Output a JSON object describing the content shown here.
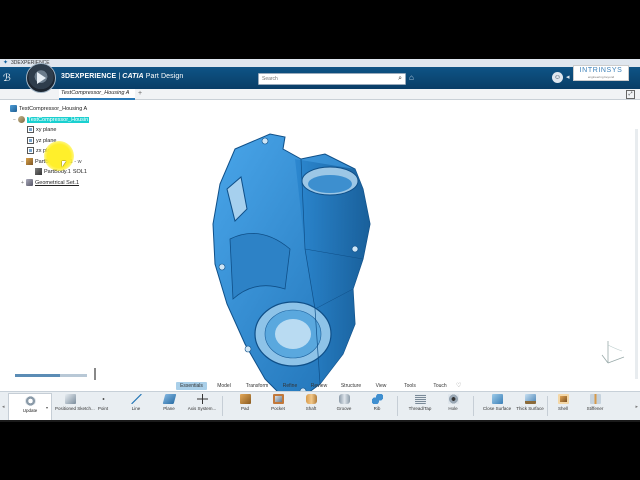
{
  "window": {
    "title": "3DEXPERIENCE"
  },
  "header": {
    "brand_main": "3DEXPERIENCE",
    "brand_sep": " | ",
    "brand_catia": "CATIA",
    "brand_app": " Part Design",
    "search_placeholder": "Search",
    "logo_name": "INTRINSYS",
    "logo_tagline": "engineering beyond"
  },
  "tabs": [
    {
      "label": "TestCompressor_Housing A"
    }
  ],
  "tree": {
    "nodes": [
      {
        "label": "TestCompressor_Housing A"
      },
      {
        "label": "TestCompressor_Housin"
      },
      {
        "label": "xy plane"
      },
      {
        "label": "yz plane"
      },
      {
        "label": "zx plane"
      },
      {
        "label": "PartBody",
        "suffix": "SOL1 - w"
      },
      {
        "label": "PartBody.1",
        "suffix": "SOL1"
      },
      {
        "label": "Geometrical Set.1"
      }
    ]
  },
  "view": {
    "slider_value": 0.62
  },
  "action_sections": [
    "Essentials",
    "Model",
    "Transform",
    "Refine",
    "Review",
    "Structure",
    "View",
    "Tools",
    "Touch"
  ],
  "active_section": "Essentials",
  "tools": [
    {
      "label": "Update"
    },
    {
      "label": "Positioned Sketch..."
    },
    {
      "label": "Point"
    },
    {
      "label": "Line"
    },
    {
      "label": "Plane"
    },
    {
      "label": "Axis System..."
    },
    {
      "label": "Pad"
    },
    {
      "label": "Pocket"
    },
    {
      "label": "Shaft"
    },
    {
      "label": "Groove"
    },
    {
      "label": "Rib"
    },
    {
      "label": "Thread/Tap"
    },
    {
      "label": "Hole"
    },
    {
      "label": "Close Surface"
    },
    {
      "label": "Thick Surface"
    },
    {
      "label": "Shell"
    },
    {
      "label": "Stiffener"
    }
  ],
  "colors": {
    "header": "#0b4a78",
    "part": "#2e8fd6",
    "highlight": "#1ad0d0",
    "active_section": "#a9cfe9"
  }
}
